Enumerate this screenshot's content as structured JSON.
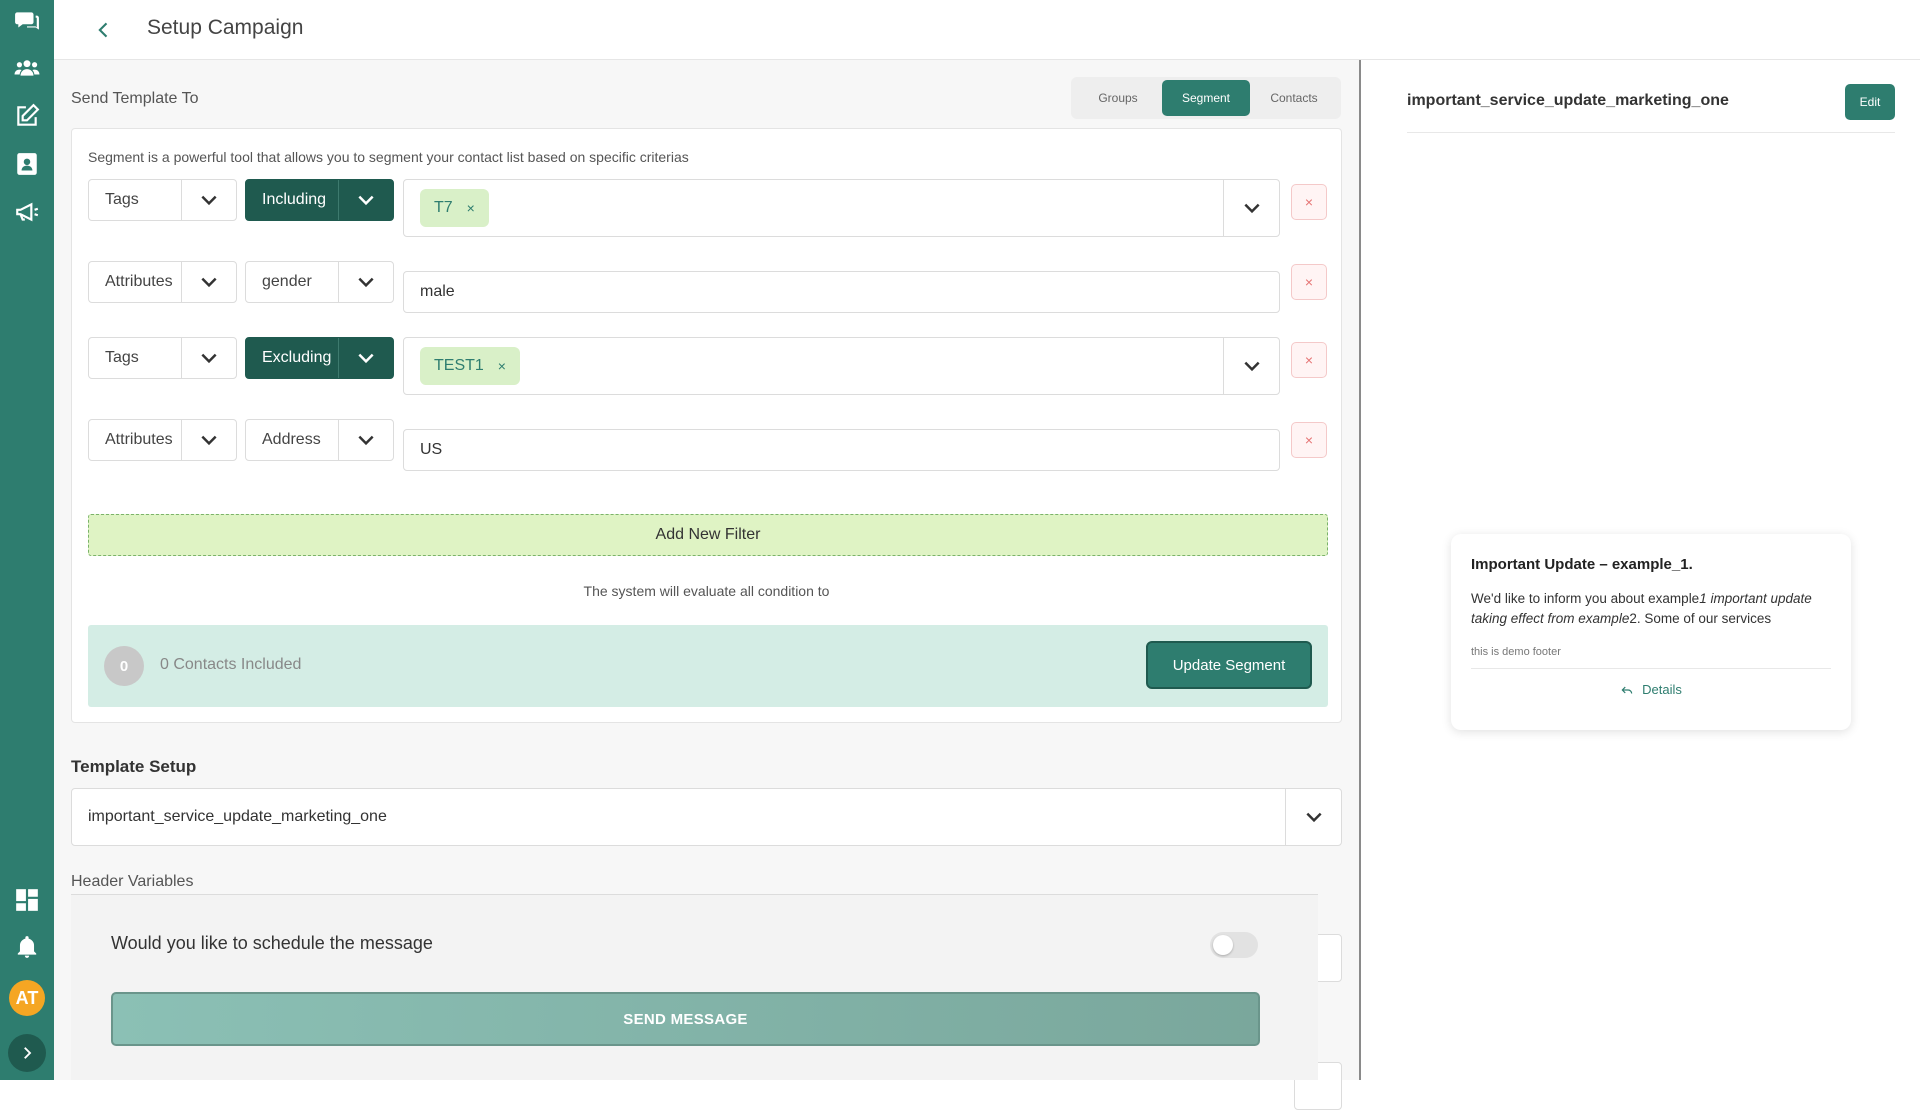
{
  "header": {
    "title": "Setup Campaign"
  },
  "send_to": {
    "label": "Send Template To",
    "tabs": [
      {
        "label": "Groups",
        "active": false
      },
      {
        "label": "Segment",
        "active": true
      },
      {
        "label": "Contacts",
        "active": false
      }
    ]
  },
  "segment": {
    "description": "Segment is a powerful tool that allows you to segment your contact list based on specific criterias",
    "filters": [
      {
        "type": "Tags",
        "operator": "Including",
        "chip": "T7"
      },
      {
        "type": "Attributes",
        "operator": "gender",
        "value": "male"
      },
      {
        "type": "Tags",
        "operator": "Excluding",
        "chip": "TEST1"
      },
      {
        "type": "Attributes",
        "operator": "Address",
        "value": "US"
      }
    ],
    "remove_glyph": "×",
    "add_filter_label": "Add New Filter",
    "evaluate_text": "The system will evaluate all condition to",
    "contacts_count": "0",
    "contacts_label": "0 Contacts Included",
    "update_button": "Update Segment"
  },
  "template_setup": {
    "label": "Template Setup",
    "selected": "important_service_update_marketing_one"
  },
  "header_variables": {
    "label": "Header Variables"
  },
  "schedule": {
    "question": "Would you like to schedule the message",
    "enabled": false,
    "send_button": "SEND MESSAGE"
  },
  "preview": {
    "template_name": "important_service_update_marketing_one",
    "edit_label": "Edit",
    "title": "Important Update – example_1.",
    "body_start": "We'd like to inform you about example",
    "body_italic": "1 important update taking effect from example",
    "body_end": "2. Some of our services",
    "footer": "this is demo footer",
    "details_label": "Details"
  },
  "user": {
    "initials": "AT"
  },
  "colors": {
    "brand": "#2e7d6f",
    "brand_dark": "#1f5a4f",
    "chip_bg": "#d9f0c8",
    "add_filter_bg": "#dff3c4",
    "contacts_bar_bg": "#d4ede5",
    "avatar": "#f5a623",
    "delete": "#e57373"
  },
  "sidebar_icons": [
    "chat-icon",
    "users-icon",
    "edit-icon",
    "contacts-icon",
    "megaphone-icon",
    "dashboard-icon",
    "bell-icon"
  ]
}
